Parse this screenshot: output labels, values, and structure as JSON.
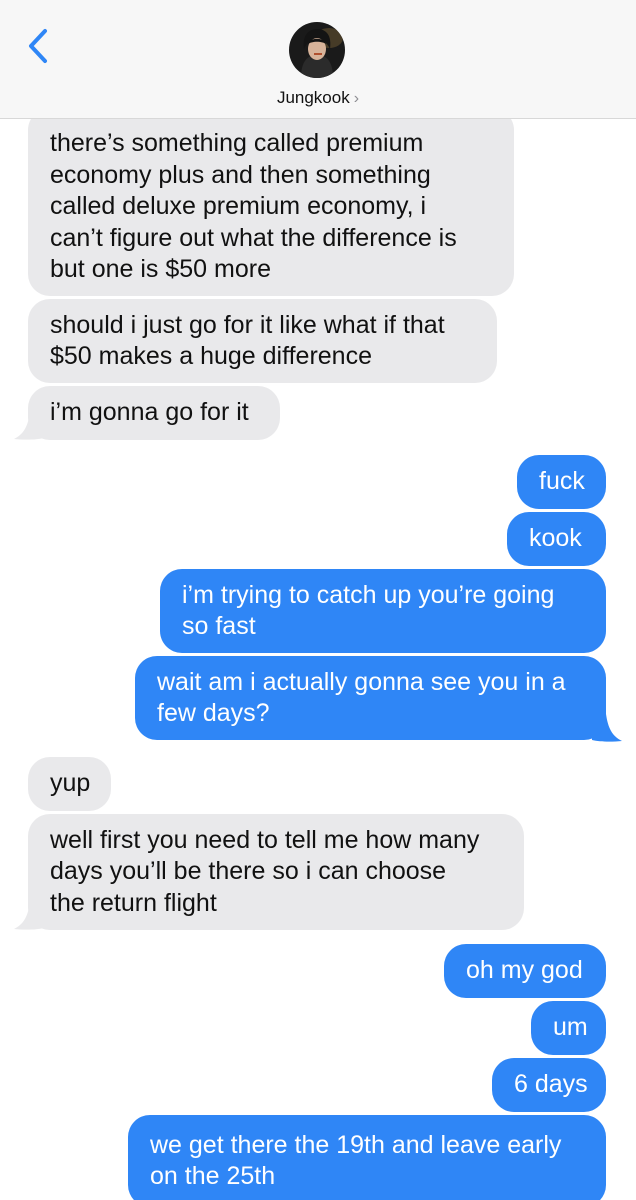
{
  "header": {
    "contact_name": "Jungkook",
    "chevron": "›",
    "back_icon": "chevron-left-icon",
    "accent": "#2f86f6"
  },
  "messages": {
    "m1": {
      "direction": "incoming",
      "lines": [
        "there’s something called premium",
        "economy plus and then something",
        "called deluxe premium economy, i",
        "can’t figure out what the difference is",
        "but one is $50 more"
      ]
    },
    "m2": {
      "direction": "incoming",
      "lines": [
        "should i just go for it like what if that",
        "$50 makes a huge difference"
      ]
    },
    "m3": {
      "direction": "incoming",
      "lines": [
        "i’m gonna go for it"
      ]
    },
    "m4": {
      "direction": "outgoing",
      "lines": [
        "fuck"
      ]
    },
    "m5": {
      "direction": "outgoing",
      "lines": [
        "kook"
      ]
    },
    "m6": {
      "direction": "outgoing",
      "lines": [
        "i’m trying to catch up you’re going",
        "so fast"
      ]
    },
    "m7": {
      "direction": "outgoing",
      "lines": [
        "wait am i actually gonna see you in a",
        "few days?"
      ]
    },
    "m8": {
      "direction": "incoming",
      "lines": [
        "yup"
      ]
    },
    "m9": {
      "direction": "incoming",
      "lines": [
        "well first you need to tell me how many",
        "days you’ll be there so i can choose",
        "the return flight"
      ]
    },
    "m10": {
      "direction": "outgoing",
      "lines": [
        "oh my god"
      ]
    },
    "m11": {
      "direction": "outgoing",
      "lines": [
        "um"
      ]
    },
    "m12": {
      "direction": "outgoing",
      "lines": [
        "6 days"
      ]
    },
    "m13": {
      "direction": "outgoing",
      "lines": [
        "we get there the 19th and leave early",
        "on the 25th"
      ]
    }
  },
  "colors": {
    "incoming_bubble": "#e9e9eb",
    "outgoing_bubble": "#2f86f6",
    "header_bg": "#f7f7f7"
  }
}
